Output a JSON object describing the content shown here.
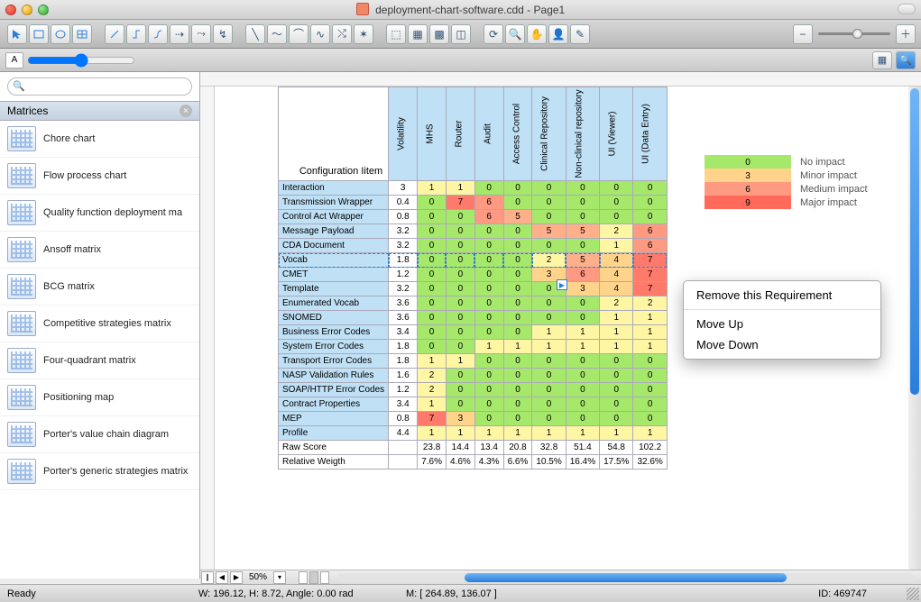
{
  "window": {
    "title": "deployment-chart-software.cdd - Page1"
  },
  "sidebar": {
    "panel_title": "Matrices",
    "search_placeholder": "",
    "items": [
      {
        "label": "Chore chart"
      },
      {
        "label": "Flow process chart"
      },
      {
        "label": "Quality function deployment ma"
      },
      {
        "label": "Ansoff matrix"
      },
      {
        "label": "BCG matrix"
      },
      {
        "label": "Competitive strategies matrix"
      },
      {
        "label": "Four-quadrant matrix"
      },
      {
        "label": "Positioning map"
      },
      {
        "label": "Porter's value chain diagram"
      },
      {
        "label": "Porter's generic strategies matrix"
      }
    ]
  },
  "matrix": {
    "config_header": "Configuration Iitem",
    "columns": [
      "Volatility",
      "MHS",
      "Router",
      "Audit",
      "Access Control",
      "Clinical Repository",
      "Non-clinical repository",
      "UI (Viewer)",
      "UI (Data Entry)"
    ],
    "rows": [
      {
        "name": "Interaction",
        "vals": [
          "3",
          "1",
          "1",
          "0",
          "0",
          "0",
          "0",
          "0",
          "0"
        ]
      },
      {
        "name": "Transmission Wrapper",
        "vals": [
          "0.4",
          "0",
          "7",
          "6",
          "0",
          "0",
          "0",
          "0",
          "0"
        ]
      },
      {
        "name": "Control Act Wrapper",
        "vals": [
          "0.8",
          "0",
          "0",
          "6",
          "5",
          "0",
          "0",
          "0",
          "0"
        ]
      },
      {
        "name": "Message Payload",
        "vals": [
          "3.2",
          "0",
          "0",
          "0",
          "0",
          "5",
          "5",
          "2",
          "6"
        ]
      },
      {
        "name": "CDA Document",
        "vals": [
          "3.2",
          "0",
          "0",
          "0",
          "0",
          "0",
          "0",
          "1",
          "6"
        ]
      },
      {
        "name": "Vocab",
        "vals": [
          "1.8",
          "0",
          "0",
          "0",
          "0",
          "2",
          "5",
          "4",
          "7"
        ],
        "selected": true
      },
      {
        "name": "CMET",
        "vals": [
          "1.2",
          "0",
          "0",
          "0",
          "0",
          "3",
          "6",
          "4",
          "7"
        ]
      },
      {
        "name": "Template",
        "vals": [
          "3.2",
          "0",
          "0",
          "0",
          "0",
          "0",
          "3",
          "4",
          "7"
        ]
      },
      {
        "name": "Enumerated Vocab",
        "vals": [
          "3.6",
          "0",
          "0",
          "0",
          "0",
          "0",
          "0",
          "2",
          "2"
        ]
      },
      {
        "name": "SNOMED",
        "vals": [
          "3.6",
          "0",
          "0",
          "0",
          "0",
          "0",
          "0",
          "1",
          "1"
        ]
      },
      {
        "name": "Business Error Codes",
        "vals": [
          "3.4",
          "0",
          "0",
          "0",
          "0",
          "1",
          "1",
          "1",
          "1"
        ]
      },
      {
        "name": "System Error Codes",
        "vals": [
          "1.8",
          "0",
          "0",
          "1",
          "1",
          "1",
          "1",
          "1",
          "1"
        ]
      },
      {
        "name": "Transport Error Codes",
        "vals": [
          "1.8",
          "1",
          "1",
          "0",
          "0",
          "0",
          "0",
          "0",
          "0"
        ]
      },
      {
        "name": "NASP Validation Rules",
        "vals": [
          "1.6",
          "2",
          "0",
          "0",
          "0",
          "0",
          "0",
          "0",
          "0"
        ]
      },
      {
        "name": "SOAP/HTTP Error Codes",
        "vals": [
          "1.2",
          "2",
          "0",
          "0",
          "0",
          "0",
          "0",
          "0",
          "0"
        ]
      },
      {
        "name": "Contract Properties",
        "vals": [
          "3.4",
          "1",
          "0",
          "0",
          "0",
          "0",
          "0",
          "0",
          "0"
        ]
      },
      {
        "name": "MEP",
        "vals": [
          "0.8",
          "7",
          "3",
          "0",
          "0",
          "0",
          "0",
          "0",
          "0"
        ]
      },
      {
        "name": "Profile",
        "vals": [
          "4.4",
          "1",
          "1",
          "1",
          "1",
          "1",
          "1",
          "1",
          "1"
        ]
      }
    ],
    "footer": [
      {
        "name": "Raw Score",
        "vals": [
          "",
          "23.8",
          "14.4",
          "13.4",
          "20.8",
          "32.8",
          "51.4",
          "54.8",
          "102.2"
        ]
      },
      {
        "name": "Relative Weigth",
        "vals": [
          "",
          "7.6%",
          "4.6%",
          "4.3%",
          "6.6%",
          "10.5%",
          "16.4%",
          "17.5%",
          "32.6%"
        ]
      }
    ]
  },
  "legend": [
    {
      "val": "0",
      "label": "No impact",
      "color": "#a6e86a"
    },
    {
      "val": "3",
      "label": "Minor impact",
      "color": "#ffd48a"
    },
    {
      "val": "6",
      "label": "Medium impact",
      "color": "#ff9a82"
    },
    {
      "val": "9",
      "label": "Major impact",
      "color": "#ff6a5a"
    }
  ],
  "context_menu": {
    "items": [
      "Remove this Requirement",
      "Move Up",
      "Move Down"
    ]
  },
  "bottom_bar": {
    "zoom": "50%"
  },
  "status": {
    "ready": "Ready",
    "dims": "W: 196.12,  H: 8.72,  Angle: 0.00 rad",
    "mouse": "M: [ 264.89, 136.07 ]",
    "id": "ID: 469747"
  },
  "chart_data": {
    "type": "heatmap",
    "title": "Configuration Iitem deployment matrix",
    "row_labels": [
      "Interaction",
      "Transmission Wrapper",
      "Control Act Wrapper",
      "Message Payload",
      "CDA Document",
      "Vocab",
      "CMET",
      "Template",
      "Enumerated Vocab",
      "SNOMED",
      "Business Error Codes",
      "System Error Codes",
      "Transport Error Codes",
      "NASP Validation Rules",
      "SOAP/HTTP Error Codes",
      "Contract Properties",
      "MEP",
      "Profile"
    ],
    "col_labels": [
      "Volatility",
      "MHS",
      "Router",
      "Audit",
      "Access Control",
      "Clinical Repository",
      "Non-clinical repository",
      "UI (Viewer)",
      "UI (Data Entry)"
    ],
    "values": [
      [
        3,
        1,
        1,
        0,
        0,
        0,
        0,
        0,
        0
      ],
      [
        0.4,
        0,
        7,
        6,
        0,
        0,
        0,
        0,
        0
      ],
      [
        0.8,
        0,
        0,
        6,
        5,
        0,
        0,
        0,
        0
      ],
      [
        3.2,
        0,
        0,
        0,
        0,
        5,
        5,
        2,
        6
      ],
      [
        3.2,
        0,
        0,
        0,
        0,
        0,
        0,
        1,
        6
      ],
      [
        1.8,
        0,
        0,
        0,
        0,
        2,
        5,
        4,
        7
      ],
      [
        1.2,
        0,
        0,
        0,
        0,
        3,
        6,
        4,
        7
      ],
      [
        3.2,
        0,
        0,
        0,
        0,
        0,
        3,
        4,
        7
      ],
      [
        3.6,
        0,
        0,
        0,
        0,
        0,
        0,
        2,
        2
      ],
      [
        3.6,
        0,
        0,
        0,
        0,
        0,
        0,
        1,
        1
      ],
      [
        3.4,
        0,
        0,
        0,
        0,
        1,
        1,
        1,
        1
      ],
      [
        1.8,
        0,
        0,
        1,
        1,
        1,
        1,
        1,
        1
      ],
      [
        1.8,
        1,
        1,
        0,
        0,
        0,
        0,
        0,
        0
      ],
      [
        1.6,
        2,
        0,
        0,
        0,
        0,
        0,
        0,
        0
      ],
      [
        1.2,
        2,
        0,
        0,
        0,
        0,
        0,
        0,
        0
      ],
      [
        3.4,
        1,
        0,
        0,
        0,
        0,
        0,
        0,
        0
      ],
      [
        0.8,
        7,
        3,
        0,
        0,
        0,
        0,
        0,
        0
      ],
      [
        4.4,
        1,
        1,
        1,
        1,
        1,
        1,
        1,
        1
      ]
    ],
    "summary_rows": {
      "Raw Score": [
        23.8,
        14.4,
        13.4,
        20.8,
        32.8,
        51.4,
        54.8,
        102.2
      ],
      "Relative Weigth": [
        "7.6%",
        "4.6%",
        "4.3%",
        "6.6%",
        "10.5%",
        "16.4%",
        "17.5%",
        "32.6%"
      ]
    },
    "legend": [
      {
        "value": 0,
        "label": "No impact"
      },
      {
        "value": 3,
        "label": "Minor impact"
      },
      {
        "value": 6,
        "label": "Medium impact"
      },
      {
        "value": 9,
        "label": "Major impact"
      }
    ]
  }
}
